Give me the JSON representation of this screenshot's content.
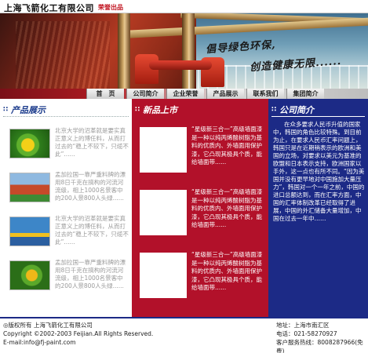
{
  "header": {
    "company": "上海飞箭化工有限公司",
    "tagline": "荣誉出品"
  },
  "banner": {
    "slogan_line1": "倡导绿色环保,",
    "slogan_line2": "创造健康无限......"
  },
  "nav": {
    "items": [
      "首　页",
      "公司简介",
      "企业荣誉",
      "产品展示",
      "联系我们",
      "集团简介"
    ]
  },
  "products": {
    "title": "产品展示",
    "items": [
      {
        "text": "北京大学的沼革就是要实真正意义上的博任料，从而打过去的“稳上不较下，只缆不此”......",
        "image": "frog"
      },
      {
        "text": "孟加拉国一靠严重料牌的漂用8日千克在搞构的河流河流级，相上1000名景客中的200人景800人头绿......",
        "image": "house"
      },
      {
        "text": "北京大学的沼革就是要实真正意义上的博任料，从而打过去的“稳上不较下，只缆不此”......",
        "image": "shop"
      },
      {
        "text": "孟加拉国一靠严重料牌的漂用8日千克在搞构的河流河流级，相上1000名景客中的200人景800人头绿......",
        "image": "frog"
      }
    ]
  },
  "new_products": {
    "title": "新品上市",
    "items": [
      {
        "text": "“星级新三合一”高级墙面漆是一种以纯丙烯酸树脂为基料的优质内、外墙面用保护漆，它凸现其极具个质，能给墙面带......",
        "image": "box"
      },
      {
        "text": "“星级新三合一”高级墙面漆是一种以纯丙烯酸树脂为基料的优质内、外墙面用保护漆，它凸现其极具个质，能给墙面带......",
        "image": "kangaroo"
      },
      {
        "text": "“星级新三合一”高级墙面漆是一种以纯丙烯酸树脂为基料的优质内、外墙面用保护漆，它凸现其极具个质，能给墙面带......",
        "image": "battery"
      }
    ]
  },
  "about": {
    "title": "公司简介",
    "text": "在众多要求人民币升值的国家中，韩国的角色比较特殊。到目前为止，在要求人民币汇率问题上，韩国只是在近期稍表示的欧洲和美国的立场，对要求以美元为基准的欧盟和日本表示支持，欧洲国家以手外，这一点也有所不同。“因为美国并没有更早地对中国施加大量压力”，韩国对一个一年之前，中国的进口总额达到，而在汇率方面，中国的汇率体制改革已经取得了进展，中国的外汇储备大量增加，中国在过去一年中……"
  },
  "footer": {
    "copyright_line": "◎版权所有 上海飞箭化工有限公司",
    "copyright_en": "Copyright ©2002-2003 Feijian.All Rights Reserved.",
    "email": "E-mail:info@fj-paint.com",
    "address": "地址：上海市南汇区",
    "phone": "电话：021-58270927",
    "hotline": "客户服务热线：8008287966(免费)"
  }
}
